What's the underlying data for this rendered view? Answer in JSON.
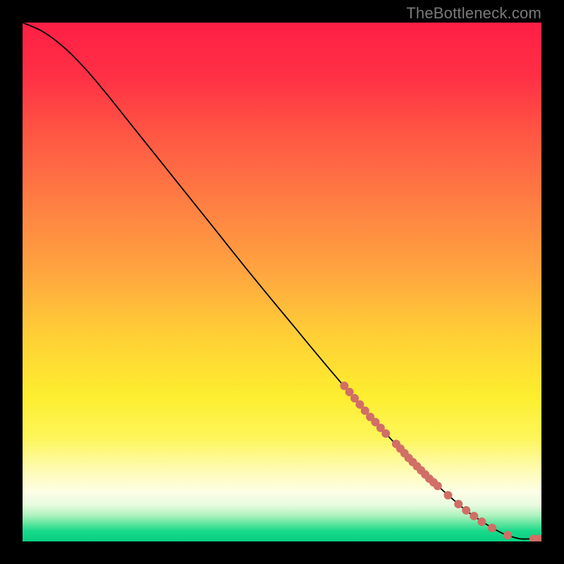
{
  "watermark": "TheBottleneck.com",
  "gradient_stops": [
    {
      "offset": 0.0,
      "color": "#ff1f45"
    },
    {
      "offset": 0.1,
      "color": "#ff2f45"
    },
    {
      "offset": 0.22,
      "color": "#ff5844"
    },
    {
      "offset": 0.35,
      "color": "#ff7f43"
    },
    {
      "offset": 0.48,
      "color": "#ffa53f"
    },
    {
      "offset": 0.6,
      "color": "#ffce36"
    },
    {
      "offset": 0.72,
      "color": "#fdee2f"
    },
    {
      "offset": 0.8,
      "color": "#fdf65a"
    },
    {
      "offset": 0.86,
      "color": "#fefbb0"
    },
    {
      "offset": 0.905,
      "color": "#fdfee6"
    },
    {
      "offset": 0.93,
      "color": "#e7fbdf"
    },
    {
      "offset": 0.95,
      "color": "#aef2be"
    },
    {
      "offset": 0.965,
      "color": "#62e6a0"
    },
    {
      "offset": 0.98,
      "color": "#19d98a"
    },
    {
      "offset": 1.0,
      "color": "#07cf82"
    }
  ],
  "chart_data": {
    "type": "line",
    "title": "",
    "xlabel": "",
    "ylabel": "",
    "xlim": [
      0,
      100
    ],
    "ylim": [
      0,
      100
    ],
    "grid": false,
    "curve": [
      {
        "x": 0.0,
        "y": 100.0
      },
      {
        "x": 4.0,
        "y": 98.2
      },
      {
        "x": 8.0,
        "y": 95.2
      },
      {
        "x": 12.0,
        "y": 91.2
      },
      {
        "x": 16.0,
        "y": 86.5
      },
      {
        "x": 20.0,
        "y": 81.5
      },
      {
        "x": 28.0,
        "y": 71.5
      },
      {
        "x": 36.0,
        "y": 61.5
      },
      {
        "x": 44.0,
        "y": 51.5
      },
      {
        "x": 52.0,
        "y": 41.8
      },
      {
        "x": 60.0,
        "y": 32.2
      },
      {
        "x": 68.0,
        "y": 23.0
      },
      {
        "x": 76.0,
        "y": 14.5
      },
      {
        "x": 84.0,
        "y": 7.2
      },
      {
        "x": 88.0,
        "y": 4.2
      },
      {
        "x": 92.0,
        "y": 1.8
      },
      {
        "x": 94.0,
        "y": 1.0
      },
      {
        "x": 96.0,
        "y": 0.5
      },
      {
        "x": 98.0,
        "y": 0.5
      },
      {
        "x": 100.0,
        "y": 0.5
      }
    ],
    "points": [
      {
        "x": 62.0,
        "y": 30.0
      },
      {
        "x": 63.0,
        "y": 28.8
      },
      {
        "x": 64.0,
        "y": 27.6
      },
      {
        "x": 65.0,
        "y": 26.4
      },
      {
        "x": 66.0,
        "y": 25.2
      },
      {
        "x": 67.0,
        "y": 24.0
      },
      {
        "x": 68.0,
        "y": 23.0
      },
      {
        "x": 69.0,
        "y": 21.9
      },
      {
        "x": 70.0,
        "y": 20.8
      },
      {
        "x": 72.0,
        "y": 18.8
      },
      {
        "x": 72.8,
        "y": 17.9
      },
      {
        "x": 73.6,
        "y": 17.0
      },
      {
        "x": 74.4,
        "y": 16.1
      },
      {
        "x": 75.2,
        "y": 15.3
      },
      {
        "x": 76.0,
        "y": 14.5
      },
      {
        "x": 76.8,
        "y": 13.7
      },
      {
        "x": 77.6,
        "y": 12.9
      },
      {
        "x": 78.4,
        "y": 12.1
      },
      {
        "x": 79.2,
        "y": 11.4
      },
      {
        "x": 80.0,
        "y": 10.7
      },
      {
        "x": 82.0,
        "y": 8.9
      },
      {
        "x": 84.0,
        "y": 7.2
      },
      {
        "x": 85.5,
        "y": 6.0
      },
      {
        "x": 87.0,
        "y": 4.9
      },
      {
        "x": 88.5,
        "y": 3.8
      },
      {
        "x": 90.5,
        "y": 2.6
      },
      {
        "x": 93.5,
        "y": 1.2
      },
      {
        "x": 98.5,
        "y": 0.5
      },
      {
        "x": 99.5,
        "y": 0.5
      }
    ],
    "point_color": "#d16e65",
    "point_radius": 6
  }
}
